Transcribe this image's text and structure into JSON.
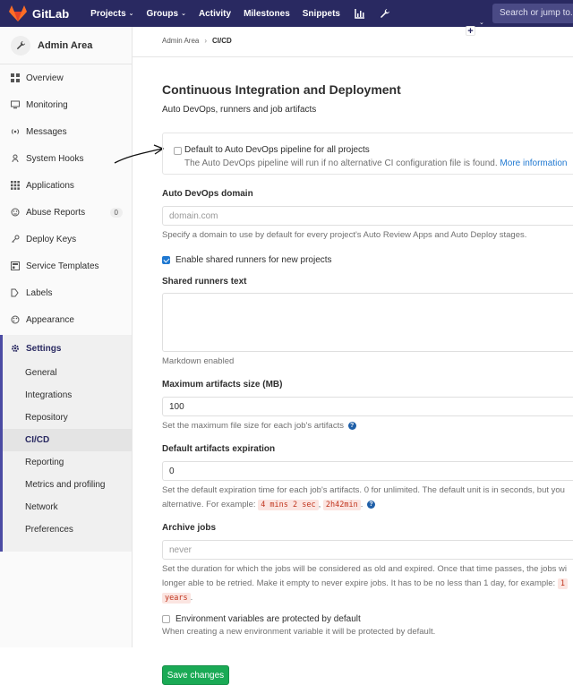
{
  "navbar": {
    "brand": "GitLab",
    "items": [
      {
        "label": "Projects",
        "caret": "⌄"
      },
      {
        "label": "Groups",
        "caret": "⌄"
      },
      {
        "label": "Activity"
      },
      {
        "label": "Milestones"
      },
      {
        "label": "Snippets"
      }
    ],
    "search_placeholder": "Search or jump to...",
    "plus_symbol": "+",
    "caret": "⌄"
  },
  "sidebar": {
    "title": "Admin Area",
    "items": [
      {
        "label": "Overview",
        "icon": "grid-icon"
      },
      {
        "label": "Monitoring",
        "icon": "monitor-icon"
      },
      {
        "label": "Messages",
        "icon": "broadcast-icon"
      },
      {
        "label": "System Hooks",
        "icon": "hook-icon"
      },
      {
        "label": "Applications",
        "icon": "apps-icon"
      },
      {
        "label": "Abuse Reports",
        "icon": "abuse-icon",
        "badge": "0"
      },
      {
        "label": "Deploy Keys",
        "icon": "key-icon"
      },
      {
        "label": "Service Templates",
        "icon": "template-icon"
      },
      {
        "label": "Labels",
        "icon": "labels-icon"
      },
      {
        "label": "Appearance",
        "icon": "palette-icon"
      }
    ],
    "settings": {
      "label": "Settings",
      "sub_items": [
        "General",
        "Integrations",
        "Repository",
        "CI/CD",
        "Reporting",
        "Metrics and profiling",
        "Network",
        "Preferences"
      ],
      "active": "CI/CD"
    }
  },
  "breadcrumb": {
    "root": "Admin Area",
    "sep": "›",
    "current": "CI/CD"
  },
  "page": {
    "title": "Continuous Integration and Deployment",
    "subtitle": "Auto DevOps, runners and job artifacts"
  },
  "autodevops": {
    "label": "Default to Auto DevOps pipeline for all projects",
    "checked": false,
    "help": "The Auto DevOps pipeline will run if no alternative CI configuration file is found.",
    "link": "More information"
  },
  "domain": {
    "label": "Auto DevOps domain",
    "placeholder": "domain.com",
    "value": "",
    "help": "Specify a domain to use by default for every project's Auto Review Apps and Auto Deploy stages."
  },
  "shared_runners": {
    "label": "Enable shared runners for new projects",
    "checked": true
  },
  "runners_text": {
    "label": "Shared runners text",
    "help": "Markdown enabled"
  },
  "max_artifacts": {
    "label": "Maximum artifacts size (MB)",
    "value": "100",
    "help": "Set the maximum file size for each job's artifacts"
  },
  "artifacts_expiration": {
    "label": "Default artifacts expiration",
    "value": "0",
    "help_line1": "Set the default expiration time for each job's artifacts. 0 for unlimited. The default unit is in seconds, but you",
    "help_line2_prefix": "alternative. For example:",
    "example1": "4 mins 2 sec",
    "example2": "2h42min"
  },
  "archive_jobs": {
    "label": "Archive jobs",
    "placeholder": "never",
    "help_line1": "Set the duration for which the jobs will be considered as old and expired. Once that time passes, the jobs wi",
    "help_line2": "longer able to be retried. Make it empty to never expire jobs. It has to be no less than 1 day, for example:",
    "example_partial": "1",
    "example_line3": "years"
  },
  "env_vars": {
    "label": "Environment variables are protected by default",
    "checked": false,
    "help": "When creating a new environment variable it will be protected by default."
  },
  "save_button": "Save changes",
  "colors": {
    "navbar": "#292961",
    "accent": "#1f78d1",
    "save": "#1aaa55"
  }
}
